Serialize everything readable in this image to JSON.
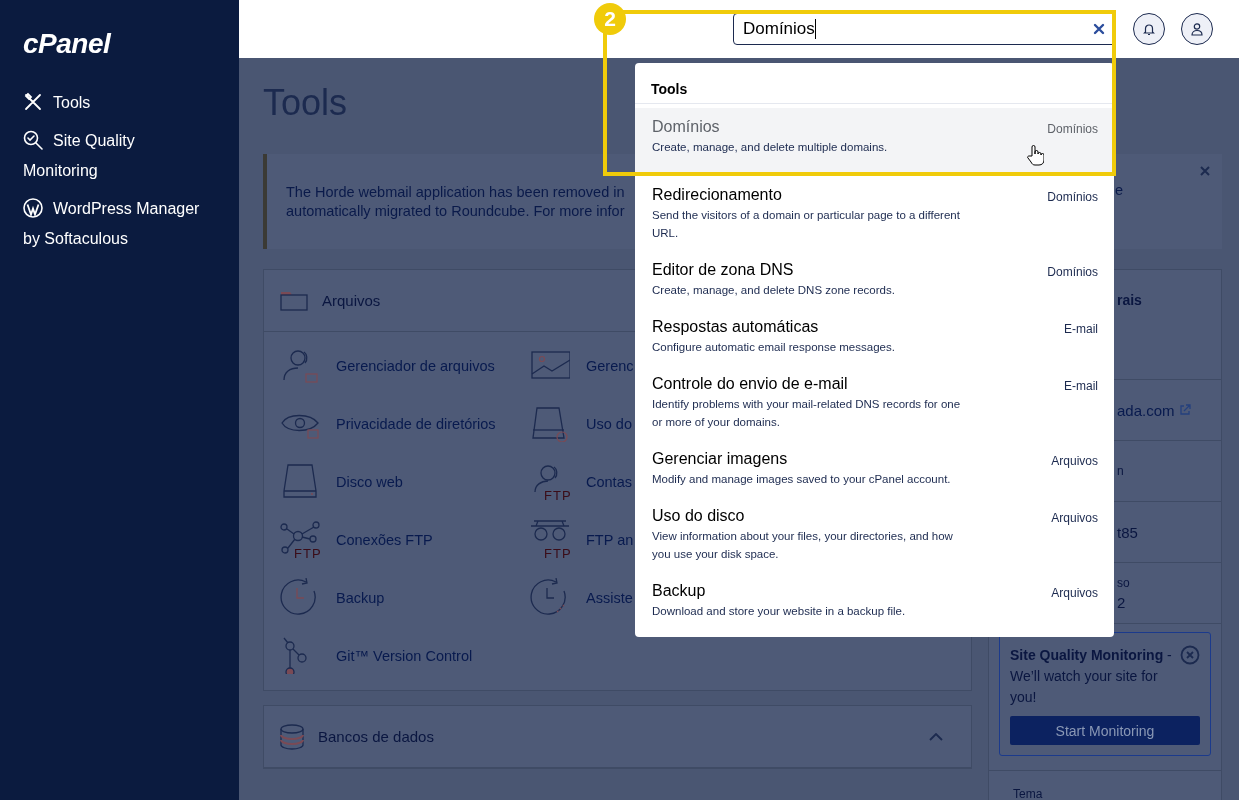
{
  "sidebar": {
    "logo": "cPanel",
    "items": [
      {
        "label": "Tools"
      },
      {
        "label": "Site Quality Monitoring"
      },
      {
        "label": "WordPress Manager by Softaculous"
      }
    ]
  },
  "search": {
    "value": "Domínios"
  },
  "page_title": "Tools",
  "notice": {
    "lines": [
      "The Horde webmail application has been removed in",
      "automatically migrated to Roundcube. For more infor"
    ],
    "tail": "e"
  },
  "sections": [
    {
      "title": "Arquivos",
      "items": [
        {
          "label": "Gerenciador de arquivos"
        },
        {
          "label": "Gerenc"
        },
        {
          "label": "Privacidade de diretórios"
        },
        {
          "label": "Uso do"
        },
        {
          "label": "Disco web"
        },
        {
          "label": "Contas",
          "badge": "FTP"
        },
        {
          "label": "Conexões FTP",
          "badge": "FTP"
        },
        {
          "label": "FTP an",
          "badge": "FTP"
        },
        {
          "label": "Backup"
        },
        {
          "label": "Assiste"
        },
        {
          "label": "Git™ Version Control"
        }
      ]
    },
    {
      "title": "Bancos de dados",
      "expanded": true
    }
  ],
  "info_rows": [
    {
      "kind": "heading",
      "text": "rais"
    },
    {
      "kind": "link",
      "text": "ada.com"
    },
    {
      "kind": "label",
      "text": "n"
    },
    {
      "kind": "value",
      "text": "t85"
    },
    {
      "kind": "pair",
      "label": "so",
      "value": "2"
    }
  ],
  "promo": {
    "text": "**Site Quality Monitoring** - We’ll watch your site for you!",
    "button": "Start Monitoring"
  },
  "theme_label": "Tema",
  "dropdown": {
    "heading": "Tools",
    "results": [
      {
        "title": "Domínios",
        "description": "Create, manage, and delete multiple domains.",
        "category": "Domínios",
        "selected": true
      },
      {
        "title": "Redirecionamento",
        "description": "Send the visitors of a domain or particular page to a different URL.",
        "category": "Domínios",
        "selected": false
      },
      {
        "title": "Editor de zona DNS",
        "description": "Create, manage, and delete DNS zone records.",
        "category": "Domínios",
        "selected": false
      },
      {
        "title": "Respostas automáticas",
        "description": "Configure automatic email response messages.",
        "category": "E-mail",
        "selected": false
      },
      {
        "title": "Controle do envio de e-mail",
        "description": "Identify problems with your mail-related DNS records for one or more of your domains.",
        "category": "E-mail",
        "selected": false
      },
      {
        "title": "Gerenciar imagens",
        "description": "Modify and manage images saved to your cPanel account.",
        "category": "Arquivos",
        "selected": false
      },
      {
        "title": "Uso do disco",
        "description": "View information about your files, your directories, and how you use your disk space.",
        "category": "Arquivos",
        "selected": false
      },
      {
        "title": "Backup",
        "description": "Download and store your website in a backup file.",
        "category": "Arquivos",
        "selected": false
      }
    ]
  },
  "annotation": {
    "step": "2"
  }
}
